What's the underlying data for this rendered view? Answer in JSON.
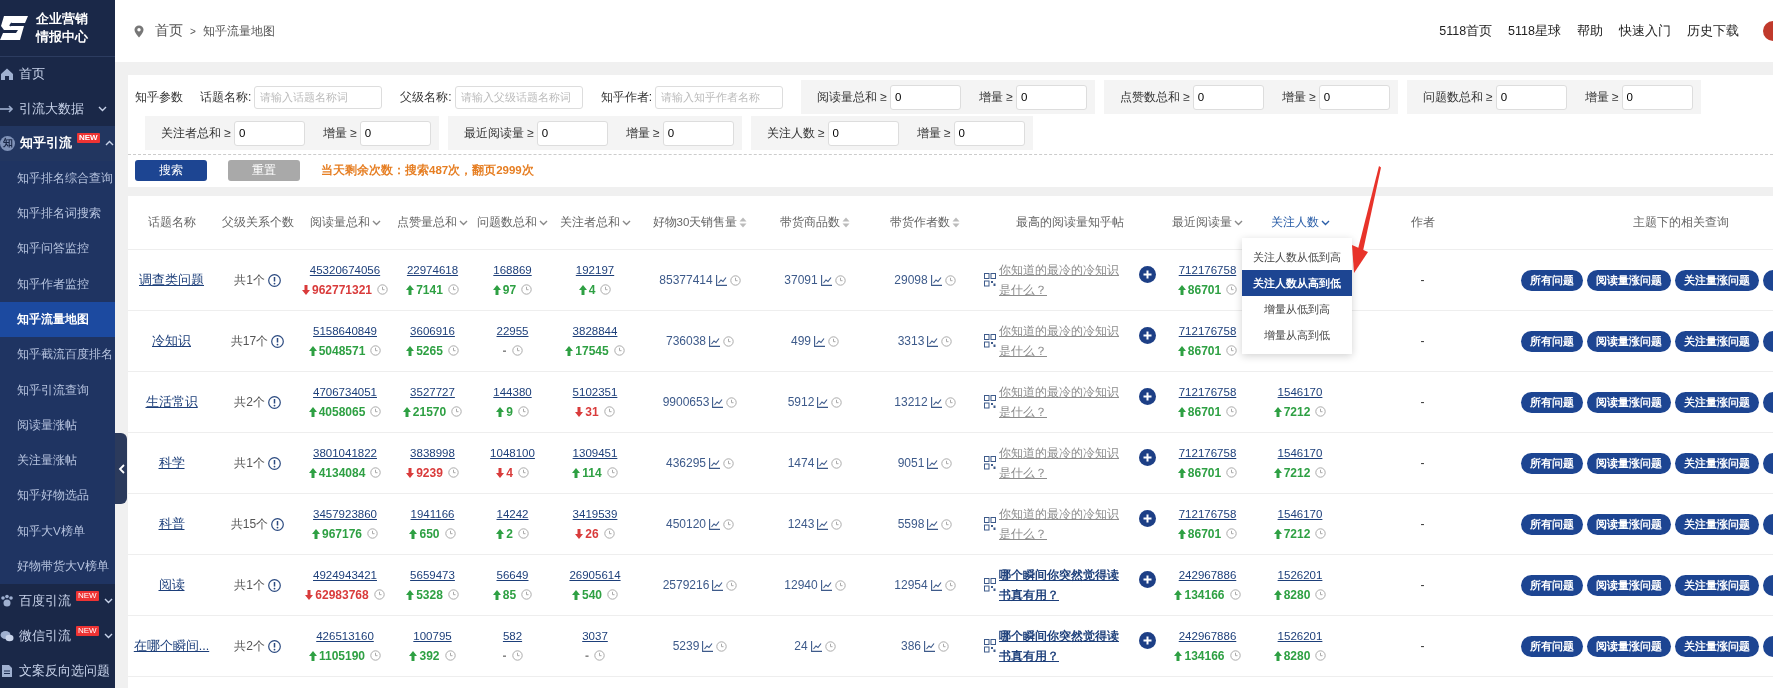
{
  "sidebar": {
    "logo_lines": [
      "企业营销",
      "情报中心"
    ],
    "items": [
      {
        "label": "首页",
        "kind": "home",
        "selected": false
      },
      {
        "label": "引流大数据",
        "kind": "arrow",
        "selected": false,
        "expanded": false
      },
      {
        "label": "知乎引流",
        "kind": "letter",
        "icon_text": "知",
        "badge": "NEW",
        "selected": true,
        "expanded": true,
        "children": [
          {
            "label": "知乎排名综合查询",
            "selected": false
          },
          {
            "label": "知乎排名词搜索",
            "selected": false
          },
          {
            "label": "知乎问答监控",
            "selected": false
          },
          {
            "label": "知乎作者监控",
            "selected": false
          },
          {
            "label": "知乎流量地图",
            "selected": true
          },
          {
            "label": "知乎截流百度排名",
            "selected": false
          },
          {
            "label": "知乎引流查询",
            "selected": false
          },
          {
            "label": "阅读量涨帖",
            "selected": false
          },
          {
            "label": "关注量涨帖",
            "selected": false
          },
          {
            "label": "知乎好物选品",
            "selected": false
          },
          {
            "label": "知乎大V榜单",
            "selected": false
          },
          {
            "label": "好物带货大V榜单",
            "selected": false
          }
        ]
      },
      {
        "label": "百度引流",
        "kind": "paw",
        "badge": "NEW",
        "selected": false,
        "expanded": false
      },
      {
        "label": "微信引流",
        "kind": "chat",
        "badge": "NEW",
        "selected": false,
        "expanded": false
      },
      {
        "label": "文案反向选问题",
        "kind": "doc",
        "selected": false
      }
    ]
  },
  "topbar": {
    "breadcrumb": [
      "首页",
      "知乎流量地图"
    ],
    "separator": ">",
    "links": [
      "5118首页",
      "5118星球",
      "帮助",
      "快速入门",
      "历史下载"
    ]
  },
  "filter": {
    "rows": [
      {
        "label": "知乎参数",
        "fields": [
          {
            "label": "话题名称:",
            "placeholder": "请输入话题名称词"
          },
          {
            "label": "父级名称:",
            "placeholder": "请输入父级话题名称词"
          },
          {
            "label": "知乎作者:",
            "placeholder": "请输入知乎作者名称"
          }
        ],
        "groups": [
          [
            {
              "label": "阅读量总和 ≥",
              "value": "0"
            },
            {
              "label": "增量 ≥",
              "value": "0"
            }
          ],
          [
            {
              "label": "点赞数总和 ≥",
              "value": "0"
            },
            {
              "label": "增量 ≥",
              "value": "0"
            }
          ],
          [
            {
              "label": "问题数总和 ≥",
              "value": "0"
            },
            {
              "label": "增量 ≥",
              "value": "0"
            }
          ]
        ]
      },
      {
        "groups": [
          [
            {
              "label": "关注者总和 ≥",
              "value": "0"
            },
            {
              "label": "增量 ≥",
              "value": "0"
            }
          ],
          [
            {
              "label": "最近阅读量 ≥",
              "value": "0"
            },
            {
              "label": "增量 ≥",
              "value": "0"
            }
          ],
          [
            {
              "label": "关注人数 ≥",
              "value": "0"
            },
            {
              "label": "增量 ≥",
              "value": "0"
            }
          ]
        ]
      }
    ],
    "buttons": [
      {
        "label": "搜索",
        "kind": "primary"
      },
      {
        "label": "重置",
        "kind": "secondary"
      }
    ],
    "quota": "当天剩余次数：搜索487次，翻页2999次"
  },
  "table": {
    "columns": [
      {
        "label": "话题名称",
        "kind": "topic"
      },
      {
        "label": "父级关系个数",
        "kind": "parents"
      },
      {
        "label": "阅读量总和",
        "kind": "metric",
        "active": false
      },
      {
        "label": "点赞量总和",
        "kind": "metric",
        "active": false
      },
      {
        "label": "问题数总和",
        "kind": "metric",
        "active": false
      },
      {
        "label": "关注者总和",
        "kind": "metric",
        "active": false
      },
      {
        "label": "好物30天销售量",
        "kind": "sales",
        "active": false
      },
      {
        "label": "带货商品数",
        "kind": "sales",
        "active": false
      },
      {
        "label": "带货作者数",
        "kind": "sales",
        "active": false
      },
      {
        "label": "最高的阅读量知乎帖",
        "kind": "post"
      },
      {
        "label": "最近阅读量",
        "kind": "metric",
        "active": false
      },
      {
        "label": "关注人数",
        "kind": "metric",
        "active": true
      },
      {
        "label": "作者",
        "kind": "author"
      },
      {
        "label": "主题下的相关查询",
        "kind": "actions"
      }
    ],
    "rows": [
      {
        "cells": [
          {
            "text": "调查类问题"
          },
          {
            "text": "共1个"
          },
          {
            "value": "45320674056",
            "change": "962771321",
            "up": false
          },
          {
            "value": "22974618",
            "change": "7141",
            "up": true
          },
          {
            "value": "168869",
            "change": "97",
            "up": true
          },
          {
            "value": "192197",
            "change": "4",
            "up": true
          },
          {
            "value": "85377414"
          },
          {
            "value": "37091"
          },
          {
            "value": "29098"
          },
          {
            "text": "你知道的最冷的冷知识是什么？",
            "visited": true
          },
          {
            "value": "712176758",
            "change": "86701",
            "up": true
          },
          null,
          {
            "text": "-"
          },
          {
            "buttons": [
              "所有问题",
              "阅读量涨问题",
              "关注量涨问题"
            ],
            "more": true
          }
        ]
      },
      {
        "cells": [
          {
            "text": "冷知识"
          },
          {
            "text": "共17个"
          },
          {
            "value": "5158640849",
            "change": "5048571",
            "up": true
          },
          {
            "value": "3606916",
            "change": "5265",
            "up": true
          },
          {
            "value": "22955",
            "change": "-"
          },
          {
            "value": "3828844",
            "change": "17545",
            "up": true
          },
          {
            "value": "736038"
          },
          {
            "value": "499"
          },
          {
            "value": "3313"
          },
          {
            "text": "你知道的最冷的冷知识是什么？",
            "visited": true
          },
          {
            "value": "712176758",
            "change": "86701",
            "up": true
          },
          null,
          {
            "text": "-"
          },
          {
            "buttons": [
              "所有问题",
              "阅读量涨问题",
              "关注量涨问题"
            ],
            "more": true
          }
        ]
      },
      {
        "cells": [
          {
            "text": "生活常识"
          },
          {
            "text": "共2个"
          },
          {
            "value": "4706734051",
            "change": "4058065",
            "up": true
          },
          {
            "value": "3527727",
            "change": "21570",
            "up": true
          },
          {
            "value": "144380",
            "change": "9",
            "up": true
          },
          {
            "value": "5102351",
            "change": "31",
            "up": false
          },
          {
            "value": "9900653"
          },
          {
            "value": "5912"
          },
          {
            "value": "13212"
          },
          {
            "text": "你知道的最冷的冷知识是什么？",
            "visited": true
          },
          {
            "value": "712176758",
            "change": "86701",
            "up": true
          },
          {
            "value": "1546170",
            "change": "7212",
            "up": true
          },
          {
            "text": "-"
          },
          {
            "buttons": [
              "所有问题",
              "阅读量涨问题",
              "关注量涨问题"
            ],
            "more": true
          }
        ]
      },
      {
        "cells": [
          {
            "text": "科学"
          },
          {
            "text": "共1个"
          },
          {
            "value": "3801041822",
            "change": "4134084",
            "up": true
          },
          {
            "value": "3838998",
            "change": "9239",
            "up": false
          },
          {
            "value": "1048100",
            "change": "4",
            "up": false
          },
          {
            "value": "1309451",
            "change": "114",
            "up": true
          },
          {
            "value": "436295"
          },
          {
            "value": "1474"
          },
          {
            "value": "9051"
          },
          {
            "text": "你知道的最冷的冷知识是什么？",
            "visited": true
          },
          {
            "value": "712176758",
            "change": "86701",
            "up": true
          },
          {
            "value": "1546170",
            "change": "7212",
            "up": true
          },
          {
            "text": "-"
          },
          {
            "buttons": [
              "所有问题",
              "阅读量涨问题",
              "关注量涨问题"
            ],
            "more": true
          }
        ]
      },
      {
        "cells": [
          {
            "text": "科普"
          },
          {
            "text": "共15个"
          },
          {
            "value": "3457923860",
            "change": "967176",
            "up": true
          },
          {
            "value": "1941166",
            "change": "650",
            "up": true
          },
          {
            "value": "14242",
            "change": "2",
            "up": true
          },
          {
            "value": "3419539",
            "change": "26",
            "up": false
          },
          {
            "value": "450120"
          },
          {
            "value": "1243"
          },
          {
            "value": "5598"
          },
          {
            "text": "你知道的最冷的冷知识是什么？",
            "visited": true
          },
          {
            "value": "712176758",
            "change": "86701",
            "up": true
          },
          {
            "value": "1546170",
            "change": "7212",
            "up": true
          },
          {
            "text": "-"
          },
          {
            "buttons": [
              "所有问题",
              "阅读量涨问题",
              "关注量涨问题"
            ],
            "more": true
          }
        ]
      },
      {
        "cells": [
          {
            "text": "阅读"
          },
          {
            "text": "共1个"
          },
          {
            "value": "4924943421",
            "change": "62983768",
            "up": false
          },
          {
            "value": "5659473",
            "change": "5328",
            "up": true
          },
          {
            "value": "56649",
            "change": "85",
            "up": true
          },
          {
            "value": "26905614",
            "change": "540",
            "up": true
          },
          {
            "value": "2579216"
          },
          {
            "value": "12940"
          },
          {
            "value": "12954"
          },
          {
            "text": "哪个瞬间你突然觉得读书真有用？",
            "visited": false
          },
          {
            "value": "242967886",
            "change": "134166",
            "up": true
          },
          {
            "value": "1526201",
            "change": "8280",
            "up": true
          },
          {
            "text": "-"
          },
          {
            "buttons": [
              "所有问题",
              "阅读量涨问题",
              "关注量涨问题"
            ],
            "more": true
          }
        ]
      },
      {
        "cells": [
          {
            "text": "在哪个瞬间..."
          },
          {
            "text": "共2个"
          },
          {
            "value": "426513160",
            "change": "1105190",
            "up": true
          },
          {
            "value": "100795",
            "change": "392",
            "up": true
          },
          {
            "value": "582",
            "change": "-"
          },
          {
            "value": "3037",
            "change": "-"
          },
          {
            "value": "5239"
          },
          {
            "value": "24"
          },
          {
            "value": "386"
          },
          {
            "text": "哪个瞬间你突然觉得读书真有用？",
            "visited": false
          },
          {
            "value": "242967886",
            "change": "134166",
            "up": true
          },
          {
            "value": "1526201",
            "change": "8280",
            "up": true
          },
          {
            "text": "-"
          },
          {
            "buttons": [
              "所有问题",
              "阅读量涨问题",
              "关注量涨问题"
            ],
            "more": true
          }
        ]
      }
    ],
    "sort_menu": {
      "options": [
        {
          "label": "关注人数从低到高",
          "selected": false
        },
        {
          "label": "关注人数从高到低",
          "selected": true
        },
        {
          "label": "增量从低到高",
          "selected": false
        },
        {
          "label": "增量从高到低",
          "selected": false
        }
      ]
    }
  },
  "annotation": {
    "kind": "arrow"
  }
}
